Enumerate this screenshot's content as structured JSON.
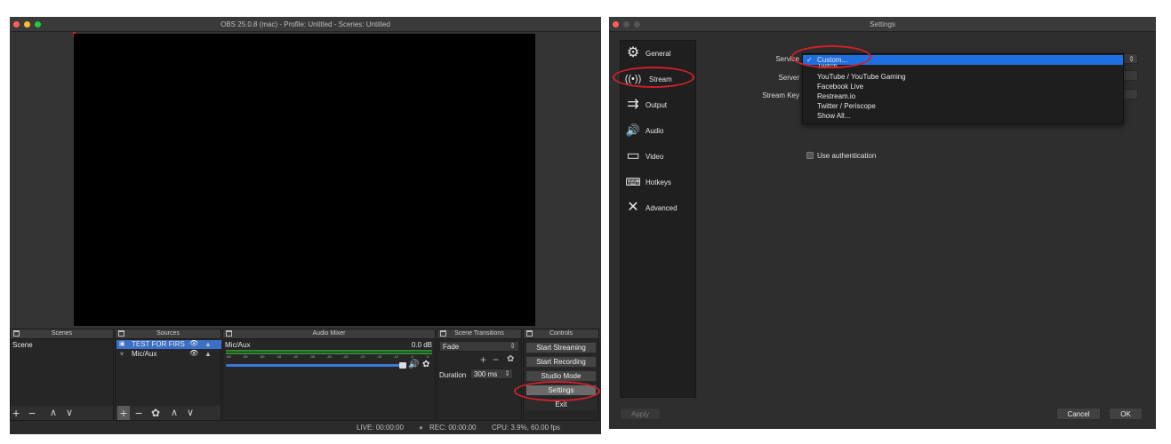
{
  "obs": {
    "title": "OBS 25.0.8 (mac) - Profile: Untitled - Scenes: Untitled",
    "docks": {
      "scenes": "Scenes",
      "sources": "Sources",
      "mixer": "Audio Mixer",
      "transitions": "Scene Transitions",
      "controls": "Controls"
    },
    "scenes_list": [
      "Scene"
    ],
    "sources_list": [
      "TEST FOR FIRS",
      "Mic/Aux"
    ],
    "mixer": {
      "channel": "Mic/Aux",
      "level": "0.0 dB",
      "scale": [
        "-60",
        "-55",
        "-50",
        "-45",
        "-40",
        "-35",
        "-30",
        "-25",
        "-20",
        "-15",
        "-10",
        "-5",
        "0"
      ]
    },
    "transitions": {
      "type": "Fade",
      "duration_label": "Duration",
      "duration_value": "300 ms"
    },
    "controls": [
      "Start Streaming",
      "Start Recording",
      "Studio Mode",
      "Settings",
      "Exit"
    ],
    "status": {
      "live": "LIVE: 00:00:00",
      "rec": "REC: 00:00:00",
      "cpu": "CPU: 3.9%, 60.00 fps"
    }
  },
  "settings": {
    "title": "Settings",
    "sidebar": [
      {
        "label": "General",
        "icon": "gear-icon"
      },
      {
        "label": "Stream",
        "icon": "antenna-icon"
      },
      {
        "label": "Output",
        "icon": "output-icon"
      },
      {
        "label": "Audio",
        "icon": "speaker-icon"
      },
      {
        "label": "Video",
        "icon": "monitor-icon"
      },
      {
        "label": "Hotkeys",
        "icon": "keyboard-icon"
      },
      {
        "label": "Advanced",
        "icon": "tools-icon"
      }
    ],
    "labels": {
      "service": "Service",
      "server": "Server",
      "stream_key": "Stream Key"
    },
    "service_options": [
      "Custom...",
      "Twitch",
      "YouTube / YouTube Gaming",
      "Facebook Live",
      "Restream.io",
      "Twitter / Periscope",
      "Show All..."
    ],
    "selected_service": "Custom...",
    "use_auth": "Use authentication",
    "buttons": {
      "apply": "Apply",
      "cancel": "Cancel",
      "ok": "OK"
    }
  },
  "colors": {
    "highlight": "#1f6fe0",
    "annotation": "#d0202a"
  }
}
